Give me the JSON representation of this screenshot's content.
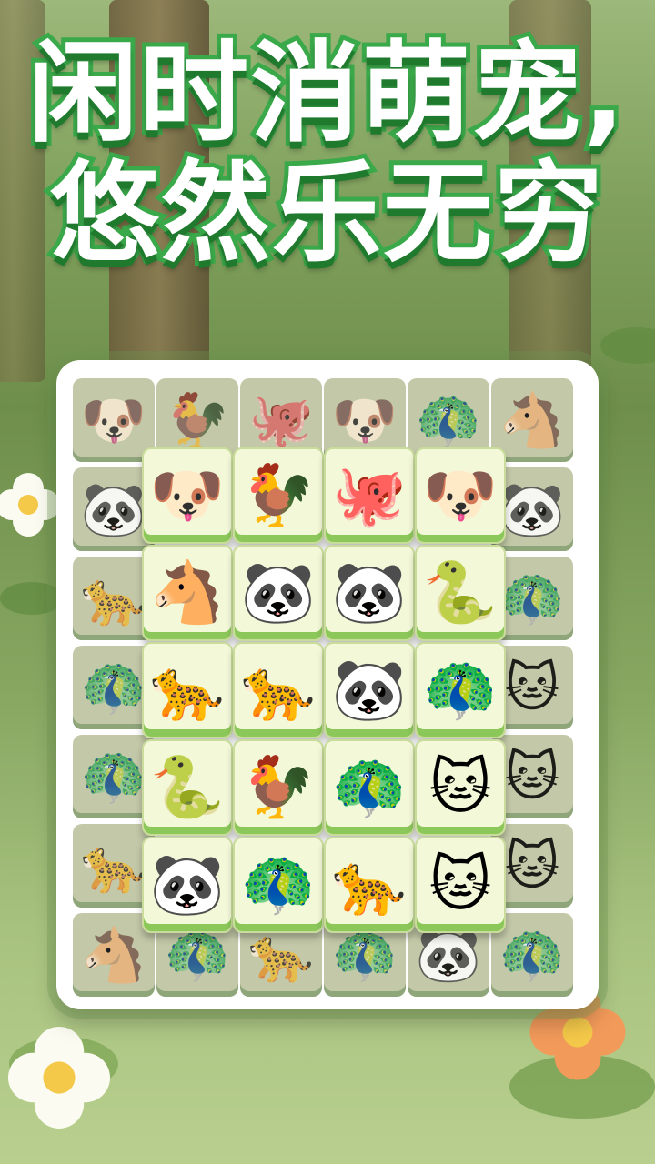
{
  "title": {
    "line1": "闲时消萌宠,",
    "line2": "悠然乐无穷"
  },
  "icons": {
    "dog": "🐶",
    "rooster": "🐓",
    "octopus": "🐙",
    "peacock": "🦚",
    "horse": "🐴",
    "panda": "🐼",
    "leopard": "🐆",
    "cat": "🐱",
    "snake": "🐍"
  },
  "back_layer": [
    [
      "dog",
      "rooster",
      "octopus",
      "dog",
      "peacock",
      "horse"
    ],
    [
      "panda",
      "",
      "",
      "",
      "",
      "panda"
    ],
    [
      "leopard",
      "",
      "",
      "",
      "",
      "peacock"
    ],
    [
      "peacock",
      "",
      "",
      "",
      "",
      "cat"
    ],
    [
      "peacock",
      "",
      "",
      "",
      "",
      "cat"
    ],
    [
      "leopard",
      "",
      "",
      "",
      "",
      "cat"
    ],
    [
      "horse",
      "peacock",
      "leopard",
      "peacock",
      "panda",
      "peacock"
    ]
  ],
  "front_layer": [
    [
      "dog",
      "rooster",
      "octopus",
      "dog"
    ],
    [
      "horse",
      "panda",
      "panda",
      "snake"
    ],
    [
      "leopard",
      "leopard",
      "panda",
      "peacock"
    ],
    [
      "snake",
      "rooster",
      "peacock",
      "cat"
    ],
    [
      "panda",
      "peacock",
      "leopard",
      "cat"
    ]
  ]
}
